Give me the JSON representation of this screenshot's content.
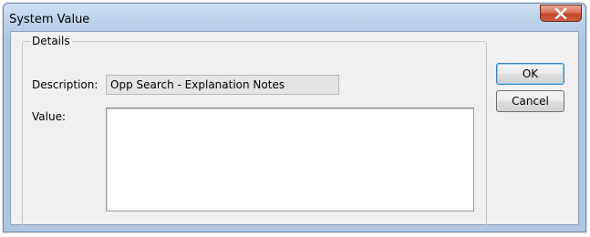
{
  "window": {
    "title": "System Value",
    "close_icon": "close-x-icon"
  },
  "details": {
    "group_label": "Details",
    "description_label": "Description:",
    "description_value": "Opp Search - Explanation Notes",
    "value_label": "Value:",
    "value_text": ""
  },
  "buttons": {
    "ok_label": "OK",
    "cancel_label": "Cancel"
  },
  "colors": {
    "title_bar": "#bcd2ea",
    "close_button": "#c2452a",
    "dialog_background": "#f0f0f0",
    "readonly_field": "#e4e4e4"
  }
}
